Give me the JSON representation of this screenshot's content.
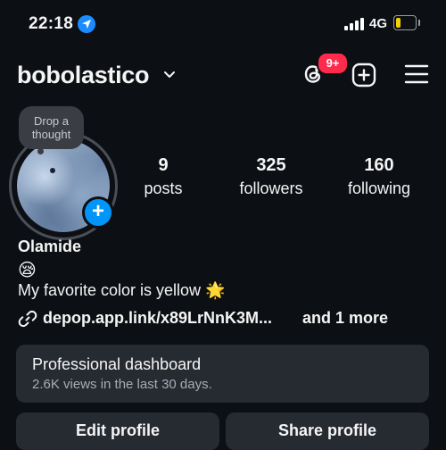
{
  "status_bar": {
    "time": "22:18",
    "network": "4G",
    "location_icon": "location-arrow-icon",
    "signal_icon": "signal-bars-icon",
    "battery_icon": "battery-low-icon",
    "battery_level": 0.25
  },
  "header": {
    "username": "bobolastico",
    "notification_badge": "9+",
    "icons": [
      "chevron-down-icon",
      "threads-icon",
      "plus-square-icon",
      "hamburger-menu-icon"
    ]
  },
  "profile": {
    "thought_bubble": "Drop a thought",
    "stats": [
      {
        "value": "9",
        "label": "posts"
      },
      {
        "value": "325",
        "label": "followers"
      },
      {
        "value": "160",
        "label": "following"
      }
    ],
    "display_name": "Olamide",
    "emoji": "😪",
    "bio": "My favorite color is yellow 🌟",
    "link": "depop.app.link/x89LrNnK3M...",
    "link_more": "and 1 more"
  },
  "dashboard": {
    "title": "Professional dashboard",
    "subtitle": "2.6K views in the last 30 days."
  },
  "actions": {
    "edit_label": "Edit profile",
    "share_label": "Share profile"
  },
  "colors": {
    "background": "#0c0f14",
    "card": "#262a31",
    "accent_blue": "#0095f6",
    "badge_red": "#ff2b4d",
    "battery_yellow": "#f5d000"
  }
}
